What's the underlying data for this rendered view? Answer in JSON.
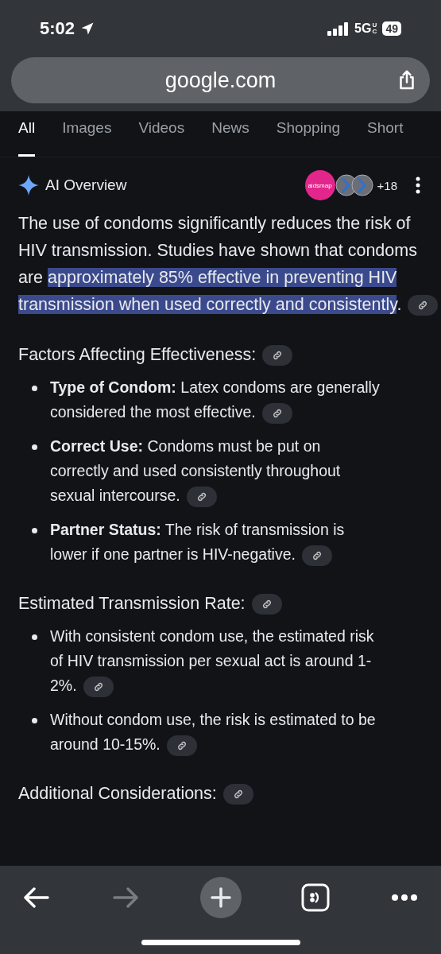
{
  "status_bar": {
    "time": "5:02",
    "network": "5G",
    "network_suffix": "UC",
    "battery": "49"
  },
  "address_bar": {
    "url": "google.com"
  },
  "tabs": [
    {
      "label": "All",
      "selected": true
    },
    {
      "label": "Images",
      "selected": false
    },
    {
      "label": "Videos",
      "selected": false
    },
    {
      "label": "News",
      "selected": false
    },
    {
      "label": "Shopping",
      "selected": false
    },
    {
      "label": "Short",
      "selected": false
    }
  ],
  "ai_overview": {
    "title": "AI Overview",
    "source_logo": "aidsmap",
    "source_count": "+18",
    "intro": [
      {
        "text": "The use of condoms significantly reduces the risk of HIV transmission. Studies have shown that condoms are ",
        "highlighted": false
      },
      {
        "text": "approximately 85% effective in preventing HIV transmission when used correctly and consistently",
        "highlighted": true
      },
      {
        "text": ".",
        "highlighted": false
      }
    ],
    "sections": [
      {
        "heading": "Factors Affecting Effectiveness:",
        "items": [
          "**Type of Condom:** Latex condoms are generally considered the most effective.",
          "**Correct Use:** Condoms must be put on correctly and used consistently throughout sexual intercourse.",
          "**Partner Status:** The risk of transmission is lower if one partner is HIV-negative."
        ]
      },
      {
        "heading": "Estimated Transmission Rate:",
        "items": [
          "With consistent condom use, the estimated risk of HIV transmission per sexual act is around 1-2%.",
          "Without condom use, the risk is estimated to be around 10-15%."
        ]
      },
      {
        "heading": "Additional Considerations:"
      }
    ]
  },
  "toolbar": {
    "forward_disabled": true
  }
}
